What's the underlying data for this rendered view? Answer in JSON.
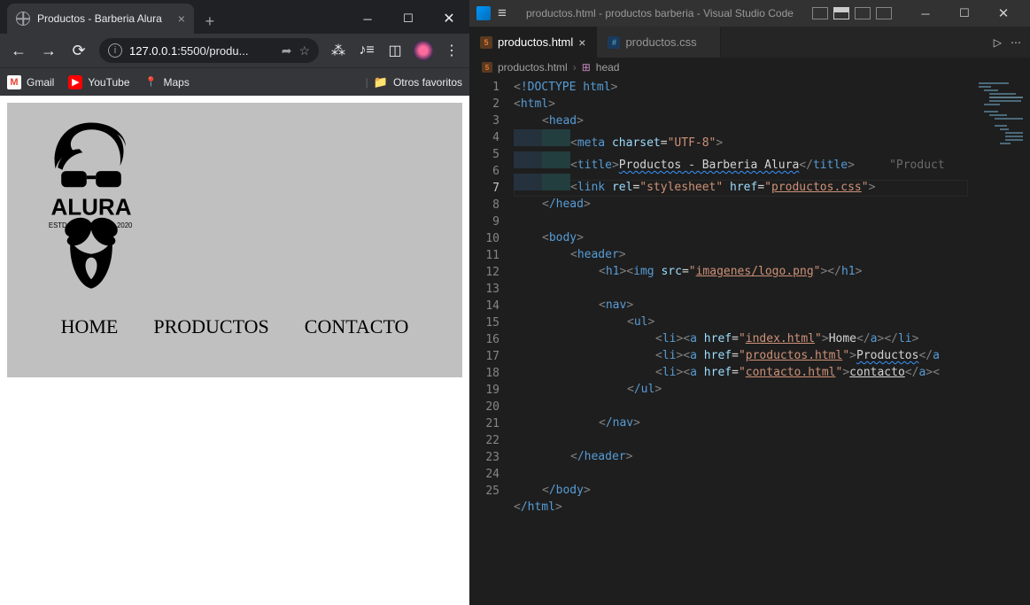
{
  "chrome": {
    "tabTitle": "Productos - Barberia Alura",
    "urlHost": "127.0.0.1",
    "urlPort": ":5500",
    "urlPath": "/produ...",
    "bookmarks": {
      "gmail": "Gmail",
      "youtube": "YouTube",
      "maps": "Maps",
      "other": "Otros favoritos"
    },
    "page": {
      "logoWord": "ALURA",
      "logoEstd": "ESTD",
      "logoYear": "2020",
      "nav": {
        "home": "HOME",
        "productos": "PRODUCTOS",
        "contacto": "CONTACTO"
      }
    }
  },
  "vscode": {
    "title": "productos.html - productos barberia - Visual Studio Code",
    "tabs": {
      "active": "productos.html",
      "inactive": "productos.css"
    },
    "breadcrumb": {
      "file": "productos.html",
      "sym": "head"
    },
    "lines": {
      "l1_doctype": "!DOCTYPE",
      "l1_html": "html",
      "l2_html": "html",
      "l3_head": "head",
      "l4_meta": "meta",
      "l4_charset": "charset",
      "l4_val": "\"UTF-8\"",
      "l5_title": "title",
      "l5_text": "Productos - Barberia Alura",
      "l5_hint": "\"Product",
      "l6_link": "link",
      "l6_rel": "rel",
      "l6_relv": "\"stylesheet\"",
      "l6_href": "href",
      "l6_hrefv_pre": "\"",
      "l6_hrefv_text": "productos.css",
      "l6_hrefv_post": "\"",
      "l7_head": "/head",
      "l9_body": "body",
      "l10_header": "header",
      "l11_h1": "h1",
      "l11_img": "img",
      "l11_src": "src",
      "l11_srcv_pre": "\"",
      "l11_srcv_text": "imagenes/logo.png",
      "l11_srcv_post": "\"",
      "l13_nav": "nav",
      "l14_ul": "ul",
      "l15_li": "li",
      "l15_a": "a",
      "l15_href": "href",
      "l15_hv_pre": "\"",
      "l15_hv_text": "index.html",
      "l15_hv_post": "\"",
      "l15_tx": "Home",
      "l16_hv_text": "productos.html",
      "l16_tx": "Productos",
      "l17_hv_text": "contacto.html",
      "l17_tx": "contacto",
      "l18_ul": "/ul",
      "l20_nav": "/nav",
      "l22_header": "/header",
      "l24_body": "/body",
      "l25_html": "/html"
    }
  }
}
